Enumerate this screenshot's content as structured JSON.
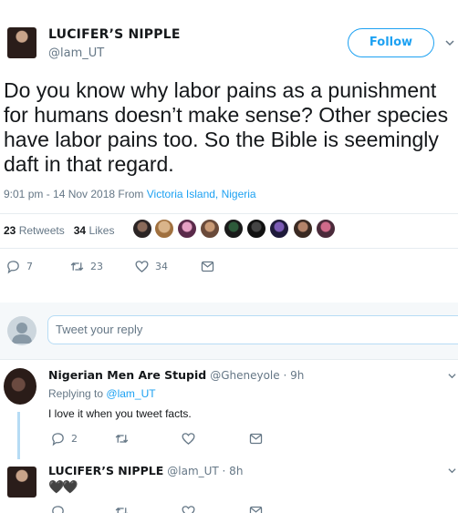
{
  "tweet": {
    "author_name": "LUCIFER’S NIPPLE",
    "author_handle": "@lam_UT",
    "follow_label": "Follow",
    "text": "Do you know why labor pains as a punishment for humans doesn’t make sense? Other species have labor pains too. So the Bible is seemingly daft in that regard.",
    "time": "9:01 pm - 14 Nov 2018",
    "from_label": "From",
    "location": "Victoria Island, Nigeria",
    "retweets_count": "23",
    "retweets_label": "Retweets",
    "likes_count": "34",
    "likes_label": "Likes",
    "actions": {
      "reply_count": "7",
      "retweet_count": "23",
      "like_count": "34"
    }
  },
  "reply_box": {
    "placeholder": "Tweet your reply"
  },
  "replies": [
    {
      "name": "Nigerian Men Are Stupid",
      "handle": "@Gheneyole · 9h",
      "replying_prefix": "Replying to",
      "replying_to": "@lam_UT",
      "text": "I love it when you tweet facts.",
      "reply_count": "2"
    },
    {
      "name": "LUCIFER’S NIPPLE",
      "handle": "@lam_UT · 8h",
      "text": "🖤🖤"
    }
  ],
  "colors": {
    "accent": "#1da1f2",
    "muted": "#657786",
    "text": "#14171a",
    "divider": "#e6ecf0"
  },
  "icons": [
    "reply-icon",
    "retweet-icon",
    "like-icon",
    "message-icon",
    "chevron-down-icon"
  ]
}
